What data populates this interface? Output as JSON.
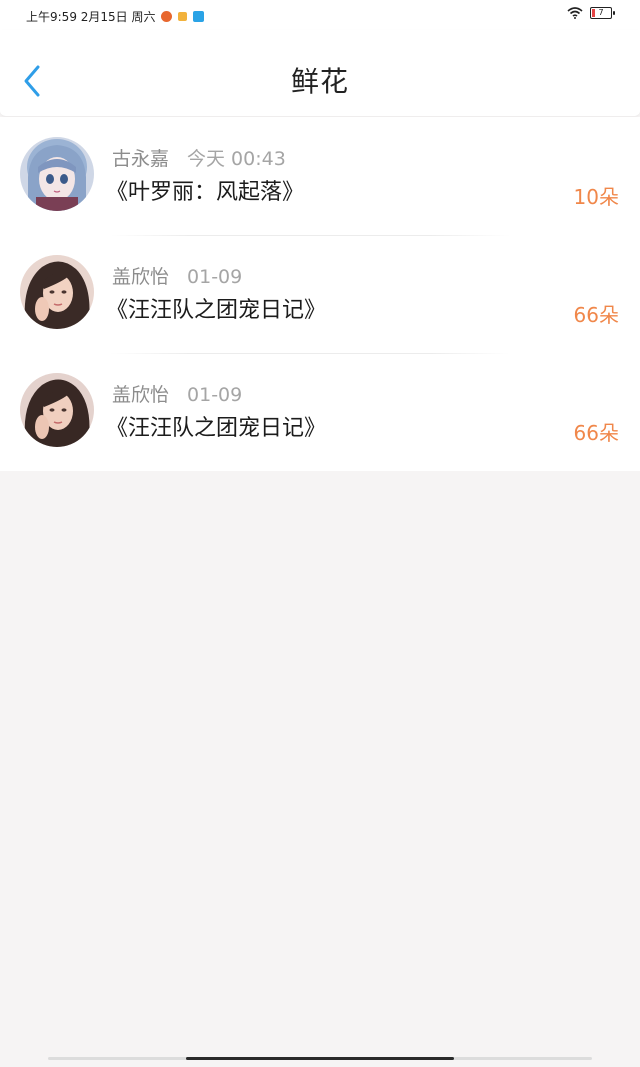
{
  "status_bar": {
    "time_text": "上午9:59 2月15日 周六",
    "battery_level": "7",
    "notification_icons": [
      "app-icon-orange",
      "app-icon-food",
      "app-icon-blue"
    ]
  },
  "header": {
    "title": "鲜花",
    "back_icon": "chevron-left-icon"
  },
  "list": {
    "items": [
      {
        "user": "古永嘉",
        "time": "今天 00:43",
        "book": "《叶罗丽：风起落》",
        "amount": "10朵",
        "avatar": "anime-girl-avatar"
      },
      {
        "user": "盖欣怡",
        "time": "01-09",
        "book": "《汪汪队之团宠日记》",
        "amount": "66朵",
        "avatar": "girl-photo-avatar"
      },
      {
        "user": "盖欣怡",
        "time": "01-09",
        "book": "《汪汪队之团宠日记》",
        "amount": "66朵",
        "avatar": "girl-photo-avatar"
      }
    ]
  },
  "colors": {
    "accent_blue": "#2f9ee8",
    "amount_orange": "#f0874a",
    "page_background": "#f6f4f4"
  }
}
